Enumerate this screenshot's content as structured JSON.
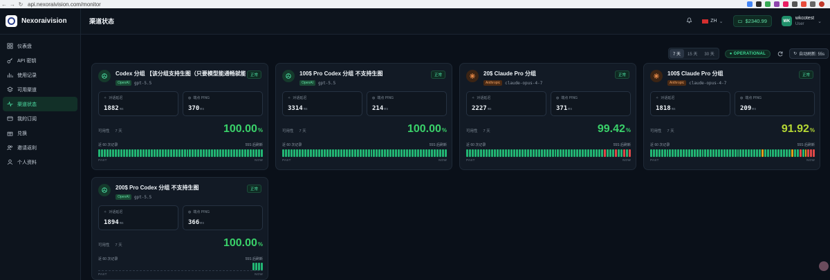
{
  "browser": {
    "url": "api.nexoraivision.com/monitor"
  },
  "brand": {
    "name": "Nexoraivision"
  },
  "sidebar": {
    "items": [
      {
        "label": "仪表盘",
        "icon": "grid-icon"
      },
      {
        "label": "API 密钥",
        "icon": "key-icon"
      },
      {
        "label": "使用记录",
        "icon": "bar-chart-icon"
      },
      {
        "label": "可用渠道",
        "icon": "layers-icon"
      },
      {
        "label": "渠道状态",
        "icon": "pulse-icon",
        "active": true
      },
      {
        "label": "我的订阅",
        "icon": "card-icon"
      },
      {
        "label": "兑换",
        "icon": "gift-icon"
      },
      {
        "label": "邀请返利",
        "icon": "users-icon"
      },
      {
        "label": "个人资料",
        "icon": "user-icon"
      }
    ]
  },
  "header": {
    "title": "渠道状态",
    "language": "ZH",
    "balance": "$2340.99",
    "user": {
      "initials": "WK",
      "name": "wkcotest",
      "role": "User"
    }
  },
  "filters": {
    "ranges": [
      "7 天",
      "15 天",
      "30 天"
    ],
    "selected_range": "7 天",
    "operational": "OPERATIONAL",
    "auto_refresh": "自动刷新: 55s"
  },
  "labels": {
    "latency": "对话延迟",
    "ping": "端点 PING",
    "unit": "ms",
    "availability": "可用性",
    "period": "7 天",
    "history": "近 60 次记录",
    "countdown": "55S 后刷新",
    "past": "PAST",
    "now": "NOW",
    "status": "正常"
  },
  "colors": {
    "ok": "#22b573",
    "warn": "#e0a11a",
    "err": "#e04848",
    "pct_green": "#3ad26a",
    "pct_yellow": "#b6d934"
  },
  "cards": [
    {
      "title": "Codex 分组 【该分组支持生图（只要模型能通畅就能...",
      "provider": "OpenAI",
      "model": "gpt-5.5",
      "latency": "1882",
      "ping": "370",
      "availability": "100.00",
      "pct_color": "#3ad26a",
      "history": "gggggggggggggggggggggggggggggggggggggggggggggggggggggggggggg"
    },
    {
      "title": "100$ Pro Codex 分组 不支持生图",
      "provider": "OpenAI",
      "model": "gpt-5.5",
      "latency": "3314",
      "ping": "214",
      "availability": "100.00",
      "pct_color": "#3ad26a",
      "history": "gggggggggggggggggggggggggggggggggggggggggggggggggggggggggggg"
    },
    {
      "title": "20$ Claude Pro 分组",
      "provider": "Anthropic",
      "model": "claude-opus-4-7",
      "latency": "2227",
      "ping": "371",
      "availability": "99.42",
      "pct_color": "#3ad26a",
      "history": "ggggggggggggggggggggggggggggggggggggggggggggggggggrgggrggrgr"
    },
    {
      "title": "100$ Claude Pro 分组",
      "provider": "Anthropic",
      "model": "claude-opus-4-7",
      "latency": "1818",
      "ping": "209",
      "availability": "91.92",
      "pct_color": "#b6d934",
      "history": "gggggggggggggggggggggggggggggggggggggggggyggggggggggyggrgyrrr"
    },
    {
      "title": "200$ Pro Codex 分组 不支持生图",
      "provider": "OpenAI",
      "model": "gpt-5.5",
      "latency": "1894",
      "ping": "366",
      "availability": "100.00",
      "pct_color": "#3ad26a",
      "history": "gggg",
      "sparse": true
    }
  ]
}
